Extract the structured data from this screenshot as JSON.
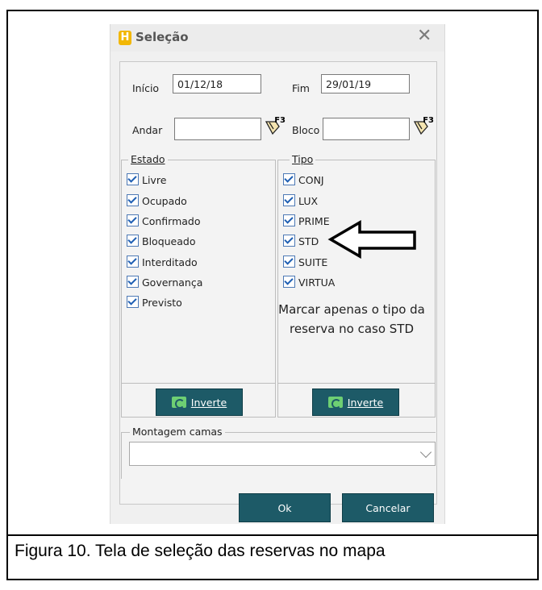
{
  "dialog": {
    "title": "Seleção",
    "icon_name": "app-h-icon",
    "close_icon": "close-icon"
  },
  "period": {
    "inicio_label": "Início",
    "inicio_value": "01/12/18",
    "fim_label": "Fim",
    "fim_value": "29/01/19"
  },
  "location": {
    "andar_label": "Andar",
    "andar_value": "",
    "bloco_label": "Bloco",
    "bloco_value": "",
    "lookup_key": "F3"
  },
  "estado": {
    "legend": "Estado",
    "items": [
      "Livre",
      "Ocupado",
      "Confirmado",
      "Bloqueado",
      "Interditado",
      "Governança",
      "Previsto"
    ],
    "button": "Inverte"
  },
  "tipo": {
    "legend": "Tipo",
    "items": [
      "CONJ",
      "LUX",
      "PRIME",
      "STD",
      "SUITE",
      "VIRTUA"
    ],
    "button": "Inverte"
  },
  "annotation": {
    "text": "Marcar apenas o tipo da reserva no caso STD"
  },
  "montagem": {
    "legend": "Montagem camas",
    "value": ""
  },
  "buttons": {
    "ok": "Ok",
    "cancel": "Cancelar"
  },
  "caption": "Figura 10. Tela de seleção das reservas no mapa",
  "colors": {
    "button_bg": "#1d5a67",
    "checkbox_check": "#1f5fb3",
    "icon_yellow": "#f2b705"
  }
}
